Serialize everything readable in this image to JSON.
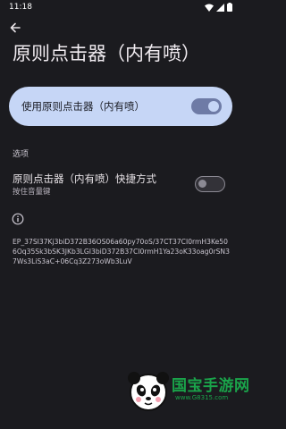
{
  "status_bar": {
    "time": "11:18",
    "icons": [
      "wifi-icon",
      "signal-icon",
      "battery-icon"
    ]
  },
  "header": {
    "back_icon": "arrow-back-icon",
    "title": "原则点击器（内有喷）"
  },
  "main_toggle": {
    "label": "使用原则点击器（内有喷）",
    "state": "on"
  },
  "options_section": {
    "header": "选项",
    "shortcut": {
      "title": "原则点击器（内有喷）快捷方式",
      "subtitle": "按住音量键",
      "state": "off"
    }
  },
  "info": {
    "icon": "info-icon",
    "text": "EP_37SI37Kj3biD372B36OS06a60py70oS/37CT37CI0rmH3Ke506Oq35Sk3bSK3JKb3LGI3biD372B37CI0rmH1Ya23oK33oag0rSN37Ws3LiS3aC+06Cq3Z273oWb3LuV"
  },
  "watermark": {
    "name": "国宝手游网",
    "url": "www.G8315.com"
  },
  "colors": {
    "background": "#1b1b1f",
    "card": "#c6d6f6",
    "switch_track_on": "#6e7ba6",
    "watermark_green": "#1aa34a"
  }
}
